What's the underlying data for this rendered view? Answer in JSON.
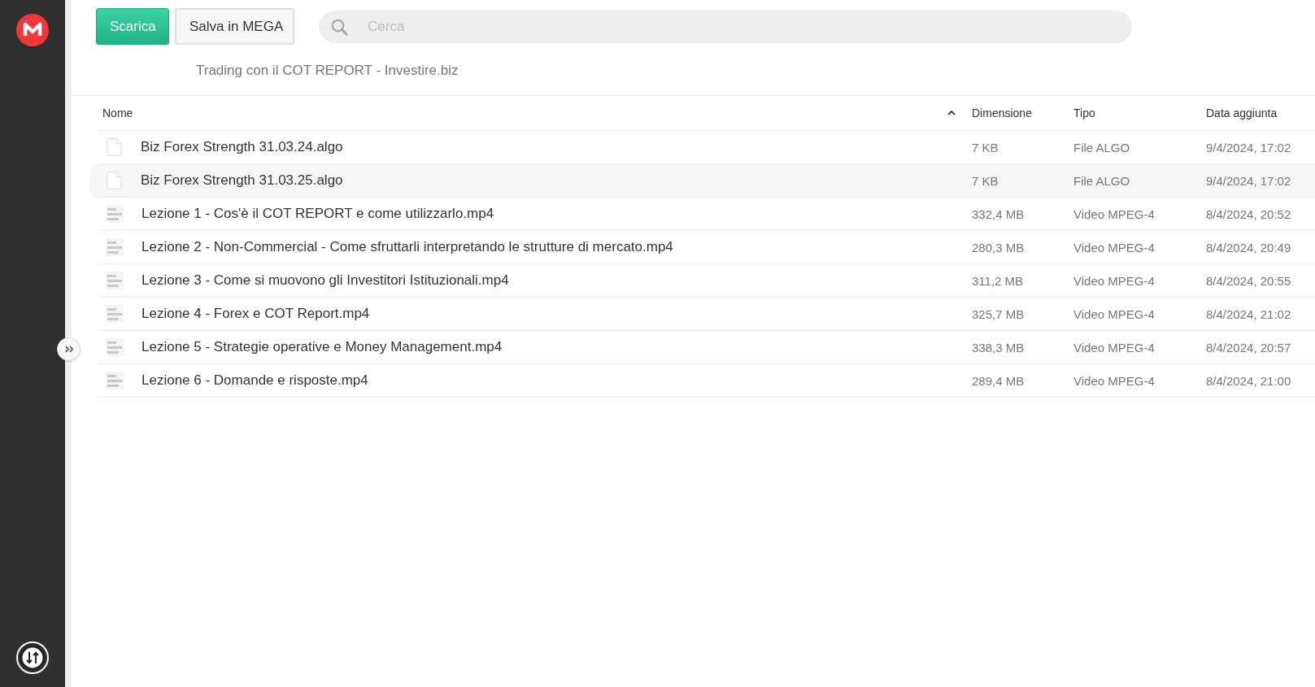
{
  "toolbar": {
    "buttons": [
      {
        "label": "Scarica",
        "kind": "primary"
      },
      {
        "label": "Salva in MEGA",
        "kind": "secondary"
      }
    ],
    "search": {
      "placeholder": "Cerca"
    }
  },
  "folder_title": "Trading con il COT REPORT - Investire.biz",
  "table": {
    "columns": [
      {
        "label": "Nome",
        "sorted": true
      },
      {
        "label": "Dimensione",
        "sorted": false
      },
      {
        "label": "Tipo",
        "sorted": false
      },
      {
        "label": "Data aggiunta",
        "sorted": false
      }
    ],
    "rows": [
      {
        "kind": "file",
        "name": "Biz Forex Strength 31.03.24.algo",
        "size": "7 KB",
        "type": "File ALGO",
        "date": "9/4/2024, 17:02",
        "selected": false
      },
      {
        "kind": "file",
        "name": "Biz Forex Strength 31.03.25.algo",
        "size": "7 KB",
        "type": "File ALGO",
        "date": "9/4/2024, 17:02",
        "selected": true
      },
      {
        "kind": "video",
        "name": "Lezione 1 - Cos'è il COT REPORT e come utilizzarlo.mp4",
        "size": "332,4 MB",
        "type": "Video MPEG-4",
        "date": "8/4/2024, 20:52",
        "selected": false
      },
      {
        "kind": "video",
        "name": "Lezione 2 - Non-Commercial - Come sfruttarli interpretando le strutture di mercato.mp4",
        "size": "280,3 MB",
        "type": "Video MPEG-4",
        "date": "8/4/2024, 20:49",
        "selected": false
      },
      {
        "kind": "video",
        "name": "Lezione 3 - Come si muovono gli Investitori Istituzionali.mp4",
        "size": "311,2 MB",
        "type": "Video MPEG-4",
        "date": "8/4/2024, 20:55",
        "selected": false
      },
      {
        "kind": "video",
        "name": "Lezione 4 - Forex e COT Report.mp4",
        "size": "325,7 MB",
        "type": "Video MPEG-4",
        "date": "8/4/2024, 21:02",
        "selected": false
      },
      {
        "kind": "video",
        "name": "Lezione 5 - Strategie operative e Money Management.mp4",
        "size": "338,3 MB",
        "type": "Video MPEG-4",
        "date": "8/4/2024, 20:57",
        "selected": false
      },
      {
        "kind": "video",
        "name": "Lezione 6 - Domande e risposte.mp4",
        "size": "289,4 MB",
        "type": "Video MPEG-4",
        "date": "8/4/2024, 21:00",
        "selected": false
      }
    ]
  }
}
